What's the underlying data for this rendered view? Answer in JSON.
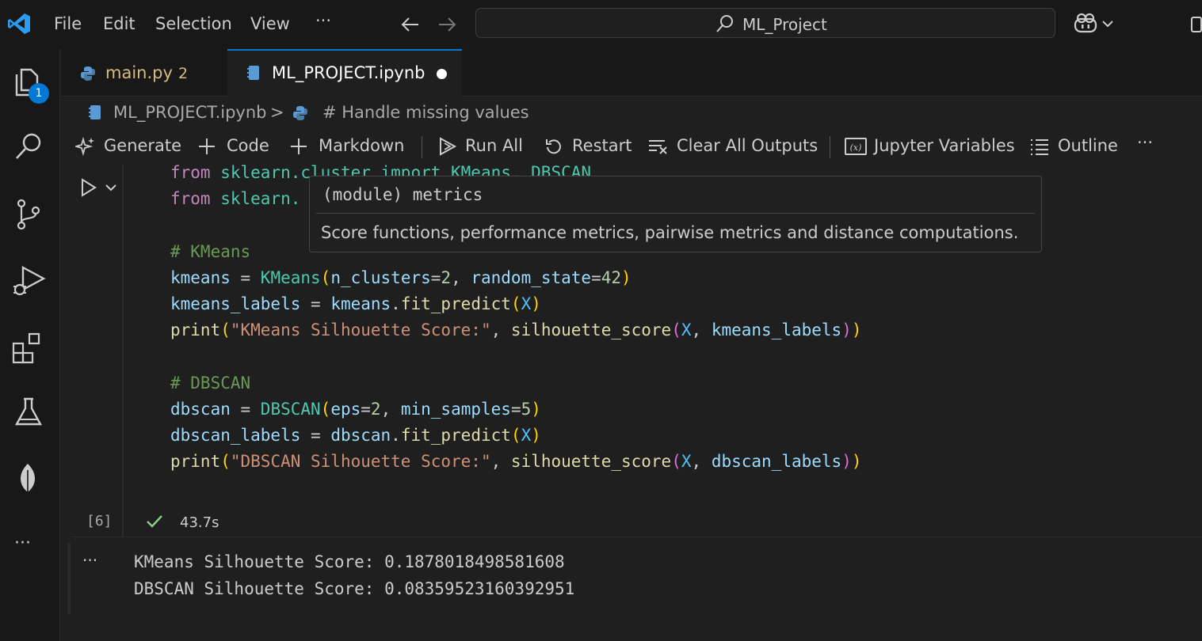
{
  "titlebar": {
    "menus": [
      "File",
      "Edit",
      "Selection",
      "View",
      "···"
    ],
    "search_text": "ML_Project"
  },
  "activity": {
    "explorer_badge": "1"
  },
  "tabs": [
    {
      "label": "main.py",
      "problems": "2",
      "icon": "python-icon"
    },
    {
      "label": "ML_PROJECT.ipynb",
      "icon": "notebook-icon",
      "dirty": true
    }
  ],
  "breadcrumb": {
    "file": "ML_PROJECT.ipynb",
    "sep": ">",
    "symbol": "# Handle missing values"
  },
  "toolbar": {
    "generate": "Generate",
    "code": "Code",
    "markdown": "Markdown",
    "run_all": "Run All",
    "restart": "Restart",
    "clear_outputs": "Clear All Outputs",
    "variables": "Jupyter Variables",
    "outline": "Outline",
    "more": "···"
  },
  "code": {
    "line1_from": "from",
    "line1_rest": " sklearn.cluster import KMeans, DBSCAN",
    "line2_from": "from",
    "line2_rest": " sklearn.",
    "cmt_kmeans": "# KMeans",
    "cmt_dbscan": "# DBSCAN"
  },
  "hover": {
    "signature": "(module) metrics",
    "doc": "Score functions, performance metrics, pairwise metrics and distance computations."
  },
  "execution": {
    "count": "[6]",
    "time": "43.7s"
  },
  "output": {
    "ellipsis": "···",
    "lines": [
      "KMeans Silhouette Score: 0.1878018498581608",
      "DBSCAN Silhouette Score: 0.08359523160392951"
    ]
  },
  "colors": {
    "accent": "#0078d4",
    "success": "#89d185"
  }
}
